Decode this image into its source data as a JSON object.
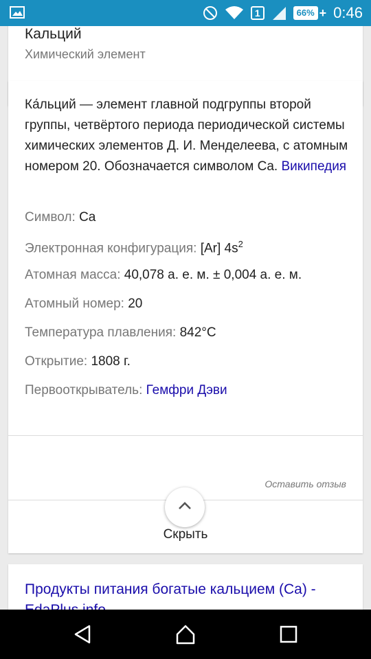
{
  "status_bar": {
    "time": "0:46",
    "battery": "66%",
    "sim": "1",
    "icons": [
      "image-icon",
      "do-not-disturb-icon",
      "wifi-icon",
      "sim-icon",
      "signal-icon",
      "battery-charging-icon"
    ]
  },
  "entity": {
    "title": "Кальций",
    "subtitle": "Химический элемент"
  },
  "description": {
    "text": "Ка́льций — элемент главной подгруппы второй группы, четвёртого периода периодической системы химических элементов Д. И. Менделеева, с атомным номером 20. Обозначается символом Ca.",
    "source_link": "Википедия"
  },
  "facts": [
    {
      "key": "Символ:",
      "value": "Ca",
      "link": false
    },
    {
      "key": "Электронная конфигурация:",
      "value": "[Ar] 4s",
      "sup": "2",
      "link": false
    },
    {
      "key": "Атомная масса:",
      "value": "40,078 а. е. м. ± 0,004 а. е. м.",
      "link": false
    },
    {
      "key": "Атомный номер:",
      "value": "20",
      "link": false
    },
    {
      "key": "Температура плавления:",
      "value": "842°C",
      "link": false
    },
    {
      "key": "Открытие:",
      "value": "1808 г.",
      "link": false
    },
    {
      "key": "Первооткрыватель:",
      "value": "Гемфри Дэви",
      "link": true
    }
  ],
  "feedback_label": "Оставить отзыв",
  "hide_label": "Скрыть",
  "next_result": {
    "title": "Продукты питания богатые кальцием (Ca) - EdaPlus.info"
  },
  "colors": {
    "status_bar": "#1a8fc0",
    "link": "#1a0dab",
    "background": "#ebebeb"
  }
}
